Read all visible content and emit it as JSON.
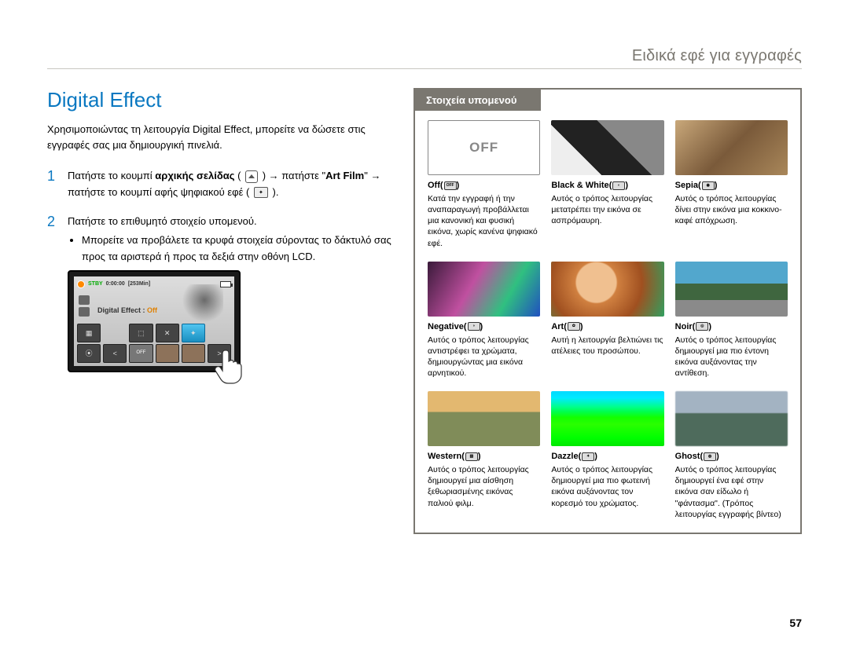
{
  "header": {
    "breadcrumb": "Ειδικά εφέ για εγγραφές"
  },
  "page_number": "57",
  "section": {
    "title": "Digital Effect",
    "intro": "Χρησιμοποιώντας τη λειτουργία Digital Effect, μπορείτε να δώσετε στις εγγραφές σας μια δημιουργική πινελιά.",
    "step1_num": "1",
    "step1_a": "Πατήστε το κουμπί ",
    "step1_b": "αρχικής σελίδας",
    "step1_c": " ( ",
    "step1_d": " ) → πατήστε \"",
    "step1_e": "Art Film",
    "step1_f": "\" → πατήστε το κουμπί αφής ψηφιακού εφέ ( ",
    "step1_g": " ).",
    "step2_num": "2",
    "step2_text": "Πατήστε το επιθυμητό στοιχείο υπομενού.",
    "step2_bullet": "Μπορείτε να προβάλετε τα κρυφά στοιχεία σύροντας το δάκτυλό σας προς τα αριστερά ή προς τα δεξιά στην οθόνη LCD."
  },
  "lcd": {
    "stby": "STBY",
    "time": "0:00:00",
    "remain": "[253Min]",
    "effect_label": "Digital Effect : ",
    "effect_value": "Off",
    "off_btn": "OFF"
  },
  "submenu": {
    "header": "Στοιχεία υπομενού",
    "off_label": "OFF",
    "items": [
      {
        "title": "Off",
        "desc": "Κατά την εγγραφή ή την αναπαραγωγή προβάλλεται μια κανονική και φυσική εικόνα, χωρίς κανένα ψηφιακό εφέ."
      },
      {
        "title": "Black & White",
        "desc": "Αυτός ο τρόπος λειτουργίας μετατρέπει την εικόνα σε ασπρόμαυρη."
      },
      {
        "title": "Sepia",
        "desc": "Αυτός ο τρόπος λειτουργίας δίνει στην εικόνα μια κοκκινο-καφέ απόχρωση."
      },
      {
        "title": "Negative",
        "desc": "Αυτός ο τρόπος λειτουργίας αντιστρέφει τα χρώματα, δημιουργώντας μια εικόνα αρνητικού."
      },
      {
        "title": "Art",
        "desc": "Αυτή η λειτουργία βελτιώνει τις ατέλειες του προσώπου."
      },
      {
        "title": "Noir",
        "desc": "Αυτός ο τρόπος λειτουργίας δημιουργεί μια πιο έντονη εικόνα αυξάνοντας την αντίθεση."
      },
      {
        "title": "Western",
        "desc": "Αυτός ο τρόπος λειτουργίας δημιουργεί μια αίσθηση ξεθωριασμένης εικόνας παλιού φιλμ."
      },
      {
        "title": "Dazzle",
        "desc": "Αυτός ο τρόπος λειτουργίας δημιουργεί μια πιο φωτεινή εικόνα αυξάνοντας τον κορεσμό του χρώματος."
      },
      {
        "title": "Ghost",
        "desc": "Αυτός ο τρόπος λειτουργίας δημιουργεί ένα εφέ στην εικόνα σαν είδωλο ή \"φάντασμα\". (Τρόπος λειτουργίας εγγραφής βίντεο)"
      }
    ]
  }
}
